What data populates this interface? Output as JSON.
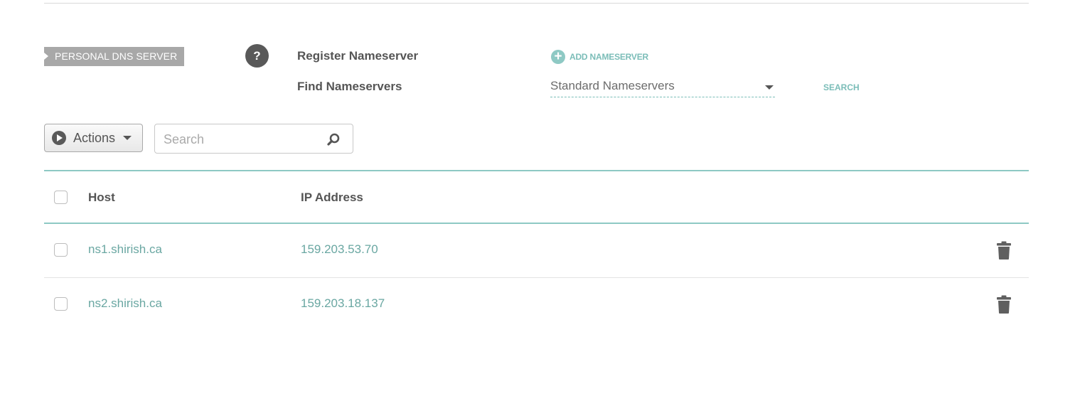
{
  "section": {
    "tag": "PERSONAL DNS SERVER",
    "help": "?"
  },
  "register": {
    "label": "Register Nameserver",
    "add_label": "ADD NAMESERVER"
  },
  "find": {
    "label": "Find Nameservers",
    "selected": "Standard Nameservers",
    "search_label": "SEARCH"
  },
  "toolbar": {
    "actions_label": "Actions",
    "search_placeholder": "Search"
  },
  "table": {
    "columns": [
      "Host",
      "IP Address"
    ],
    "rows": [
      {
        "host": "ns1.shirish.ca",
        "ip": "159.203.53.70"
      },
      {
        "host": "ns2.shirish.ca",
        "ip": "159.203.18.137"
      }
    ]
  },
  "colors": {
    "accent": "#7bbdb8",
    "tag_bg": "#a8a8a8",
    "link_text": "#6aa7a2"
  },
  "icons": {
    "help": "question-mark-icon",
    "add": "plus-circle-icon",
    "actions": "play-circle-icon",
    "search": "magnifier-icon",
    "delete": "trash-icon"
  }
}
